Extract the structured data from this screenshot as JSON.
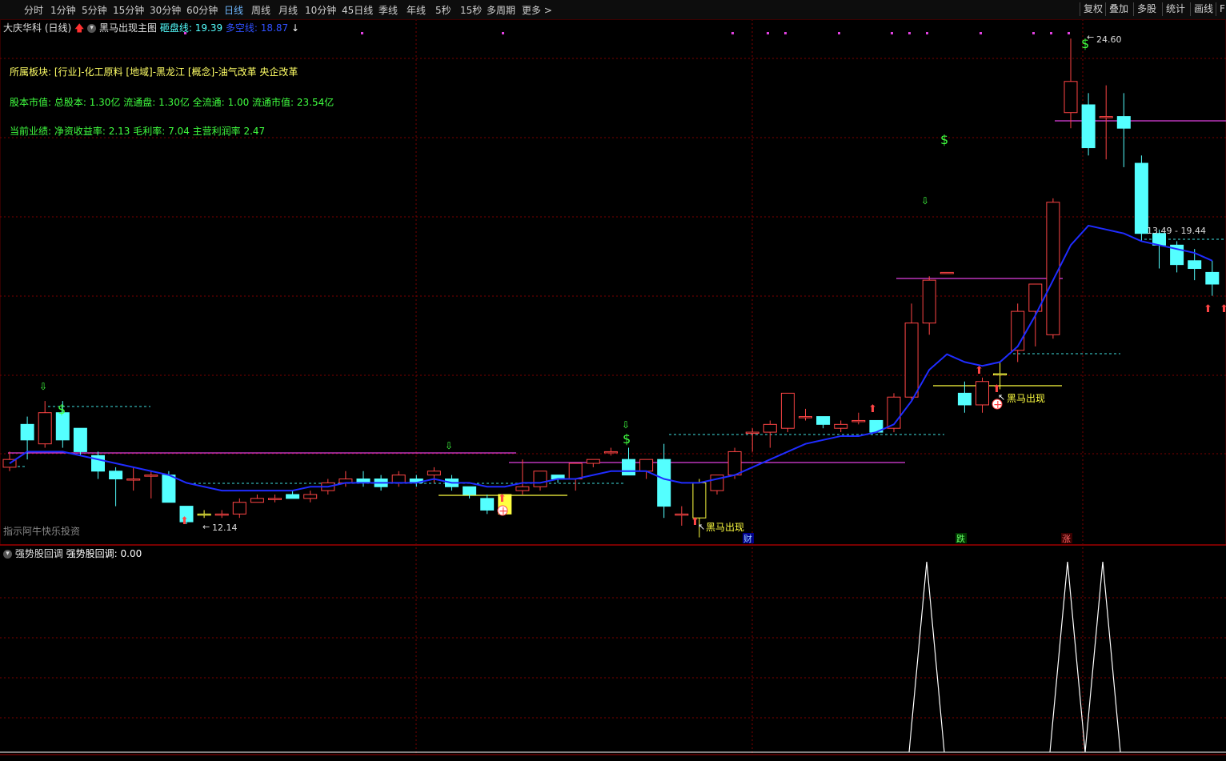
{
  "toolbar": {
    "periods": [
      "分时",
      "1分钟",
      "5分钟",
      "15分钟",
      "30分钟",
      "60分钟",
      "日线",
      "周线",
      "月线",
      "10分钟",
      "45日线",
      "季线",
      "年线",
      "5秒",
      "15秒",
      "多周期",
      "更多 >"
    ],
    "active": "日线",
    "right_buttons": [
      "复权",
      "叠加",
      "多股",
      "统计",
      "画线",
      "F"
    ]
  },
  "header": {
    "stock": "大庆华科 (日线)",
    "indicator_name": "黑马出现主图",
    "support_label": "砸盘线:",
    "support_value": "19.39",
    "trend_label": "多空线:",
    "trend_value": "18.87"
  },
  "info": {
    "sector": "所属板块: [行业]-化工原料 [地域]-黑龙江 [概念]-油气改革 央企改革",
    "cap": "股本市值: 总股本: 1.30亿 流通盘: 1.30亿 全流通: 1.00 流通市值: 23.54亿",
    "perf": "当前业绩: 净资收益率: 2.13 毛利率: 7.04 主营利润率 2.47"
  },
  "annotations": {
    "high": "24.60",
    "low": "12.14",
    "range": "13.49 - 19.44",
    "horse": "黑马出现",
    "cai": "财",
    "die": "跌",
    "zhang": "涨",
    "watermark": "指示阿牛快乐投资"
  },
  "sub": {
    "name": "强势股回调",
    "label": "强势股回调:",
    "value": "0.00"
  },
  "colors": {
    "up": "#ff4545",
    "down": "#54ffff",
    "ma": "#1f2cff",
    "magenta": "#e040e0",
    "grid": "#7a0000",
    "yellow": "#ffff40"
  },
  "chart_data": {
    "type": "candlestick",
    "candles": [
      {
        "o": 13.6,
        "c": 13.8,
        "h": 14.0,
        "l": 13.5
      },
      {
        "o": 14.7,
        "c": 14.3,
        "h": 14.9,
        "l": 13.8
      },
      {
        "o": 14.2,
        "c": 15.0,
        "h": 15.3,
        "l": 14.1
      },
      {
        "o": 15.0,
        "c": 14.3,
        "h": 15.3,
        "l": 14.1
      },
      {
        "o": 14.6,
        "c": 14.0,
        "h": 14.6,
        "l": 13.9
      },
      {
        "o": 13.9,
        "c": 13.5,
        "h": 14.0,
        "l": 13.3
      },
      {
        "o": 13.5,
        "c": 13.3,
        "h": 13.6,
        "l": 12.6
      },
      {
        "o": 13.3,
        "c": 13.3,
        "h": 13.6,
        "l": 13.0
      },
      {
        "o": 13.4,
        "c": 13.4,
        "h": 13.5,
        "l": 12.8
      },
      {
        "o": 13.4,
        "c": 12.7,
        "h": 13.5,
        "l": 12.7
      },
      {
        "o": 12.6,
        "c": 12.2,
        "h": 12.6,
        "l": 12.14
      },
      {
        "o": 12.4,
        "c": 12.4,
        "h": 12.5,
        "l": 12.3
      },
      {
        "o": 12.4,
        "c": 12.4,
        "h": 12.5,
        "l": 12.3
      },
      {
        "o": 12.4,
        "c": 12.7,
        "h": 12.8,
        "l": 12.3
      },
      {
        "o": 12.7,
        "c": 12.8,
        "h": 12.9,
        "l": 12.7
      },
      {
        "o": 12.8,
        "c": 12.8,
        "h": 12.9,
        "l": 12.7
      },
      {
        "o": 12.9,
        "c": 12.8,
        "h": 13.0,
        "l": 12.8
      },
      {
        "o": 12.8,
        "c": 12.9,
        "h": 13.0,
        "l": 12.7
      },
      {
        "o": 13.0,
        "c": 13.2,
        "h": 13.3,
        "l": 12.9
      },
      {
        "o": 13.2,
        "c": 13.3,
        "h": 13.5,
        "l": 13.1
      },
      {
        "o": 13.3,
        "c": 13.2,
        "h": 13.5,
        "l": 13.1
      },
      {
        "o": 13.3,
        "c": 13.1,
        "h": 13.4,
        "l": 13.0
      },
      {
        "o": 13.2,
        "c": 13.4,
        "h": 13.5,
        "l": 13.1
      },
      {
        "o": 13.3,
        "c": 13.2,
        "h": 13.4,
        "l": 13.1
      },
      {
        "o": 13.4,
        "c": 13.5,
        "h": 13.6,
        "l": 13.2
      },
      {
        "o": 13.3,
        "c": 13.1,
        "h": 13.4,
        "l": 13.0
      },
      {
        "o": 13.1,
        "c": 12.9,
        "h": 13.1,
        "l": 12.8
      },
      {
        "o": 12.8,
        "c": 12.5,
        "h": 12.9,
        "l": 12.4
      },
      {
        "o": 12.4,
        "c": 12.9,
        "h": 12.9,
        "l": 12.4
      },
      {
        "o": 13.0,
        "c": 13.1,
        "h": 13.8,
        "l": 12.9
      },
      {
        "o": 13.1,
        "c": 13.5,
        "h": 13.5,
        "l": 13.0
      },
      {
        "o": 13.4,
        "c": 13.3,
        "h": 13.4,
        "l": 13.2
      },
      {
        "o": 13.3,
        "c": 13.7,
        "h": 13.7,
        "l": 13.0
      },
      {
        "o": 13.7,
        "c": 13.8,
        "h": 13.8,
        "l": 13.6
      },
      {
        "o": 14.0,
        "c": 14.0,
        "h": 14.1,
        "l": 13.9
      },
      {
        "o": 13.8,
        "c": 13.4,
        "h": 14.1,
        "l": 13.4
      },
      {
        "o": 13.5,
        "c": 13.8,
        "h": 13.8,
        "l": 13.3
      },
      {
        "o": 13.8,
        "c": 12.6,
        "h": 14.2,
        "l": 12.3
      },
      {
        "o": 12.4,
        "c": 12.4,
        "h": 12.6,
        "l": 12.1
      },
      {
        "o": 12.3,
        "c": 13.2,
        "h": 13.3,
        "l": 11.8
      },
      {
        "o": 13.0,
        "c": 13.4,
        "h": 13.4,
        "l": 12.9
      },
      {
        "o": 13.4,
        "c": 14.0,
        "h": 14.1,
        "l": 13.3
      },
      {
        "o": 14.5,
        "c": 14.5,
        "h": 14.6,
        "l": 14.0
      },
      {
        "o": 14.5,
        "c": 14.7,
        "h": 14.8,
        "l": 14.1
      },
      {
        "o": 14.6,
        "c": 15.5,
        "h": 15.5,
        "l": 14.5
      },
      {
        "o": 14.9,
        "c": 14.9,
        "h": 15.1,
        "l": 14.8
      },
      {
        "o": 14.9,
        "c": 14.7,
        "h": 14.9,
        "l": 14.6
      },
      {
        "o": 14.6,
        "c": 14.7,
        "h": 14.8,
        "l": 14.5
      },
      {
        "o": 14.8,
        "c": 14.8,
        "h": 15.0,
        "l": 14.7
      },
      {
        "o": 14.8,
        "c": 14.5,
        "h": 14.8,
        "l": 14.5
      },
      {
        "o": 14.6,
        "c": 15.4,
        "h": 15.5,
        "l": 14.5
      },
      {
        "o": 15.4,
        "c": 17.3,
        "h": 17.8,
        "l": 15.3
      },
      {
        "o": 17.3,
        "c": 18.4,
        "h": 18.5,
        "l": 17.0
      },
      {
        "o": 18.6,
        "c": 18.6,
        "h": 18.6,
        "l": 18.6
      },
      {
        "o": 15.5,
        "c": 15.2,
        "h": 15.8,
        "l": 15.0
      },
      {
        "o": 15.2,
        "c": 15.8,
        "h": 15.9,
        "l": 15.0
      },
      {
        "o": 16.0,
        "c": 16.0,
        "h": 16.3,
        "l": 15.6
      },
      {
        "o": 16.6,
        "c": 17.6,
        "h": 17.8,
        "l": 16.3
      },
      {
        "o": 17.6,
        "c": 18.3,
        "h": 18.3,
        "l": 16.7
      },
      {
        "o": 17.0,
        "c": 20.4,
        "h": 20.5,
        "l": 16.9
      },
      {
        "o": 22.7,
        "c": 23.5,
        "h": 24.6,
        "l": 22.3
      },
      {
        "o": 22.9,
        "c": 21.8,
        "h": 23.2,
        "l": 21.6
      },
      {
        "o": 22.6,
        "c": 22.6,
        "h": 23.4,
        "l": 21.5
      },
      {
        "o": 22.6,
        "c": 22.3,
        "h": 23.2,
        "l": 21.3
      },
      {
        "o": 21.4,
        "c": 19.6,
        "h": 21.6,
        "l": 19.4
      },
      {
        "o": 19.6,
        "c": 19.3,
        "h": 19.7,
        "l": 18.7
      },
      {
        "o": 19.3,
        "c": 18.8,
        "h": 19.4,
        "l": 18.6
      },
      {
        "o": 18.9,
        "c": 18.7,
        "h": 19.2,
        "l": 18.4
      },
      {
        "o": 18.6,
        "c": 18.3,
        "h": 18.9,
        "l": 18.0
      }
    ],
    "ma": [
      13.7,
      14.0,
      14.0,
      14.0,
      13.9,
      13.8,
      13.7,
      13.6,
      13.5,
      13.4,
      13.2,
      13.1,
      13.0,
      13.0,
      13.0,
      13.0,
      13.0,
      13.1,
      13.1,
      13.2,
      13.2,
      13.2,
      13.2,
      13.2,
      13.3,
      13.2,
      13.2,
      13.1,
      13.1,
      13.2,
      13.2,
      13.3,
      13.3,
      13.4,
      13.5,
      13.5,
      13.5,
      13.3,
      13.2,
      13.2,
      13.3,
      13.4,
      13.6,
      13.8,
      14.0,
      14.2,
      14.3,
      14.4,
      14.4,
      14.5,
      14.7,
      15.3,
      16.1,
      16.5,
      16.3,
      16.2,
      16.3,
      16.7,
      17.5,
      18.4,
      19.3,
      19.8,
      19.7,
      19.6,
      19.4,
      19.3,
      19.2,
      19.1,
      18.9
    ],
    "sub_indicator": {
      "name": "强势股回调",
      "current": 0.0
    }
  }
}
